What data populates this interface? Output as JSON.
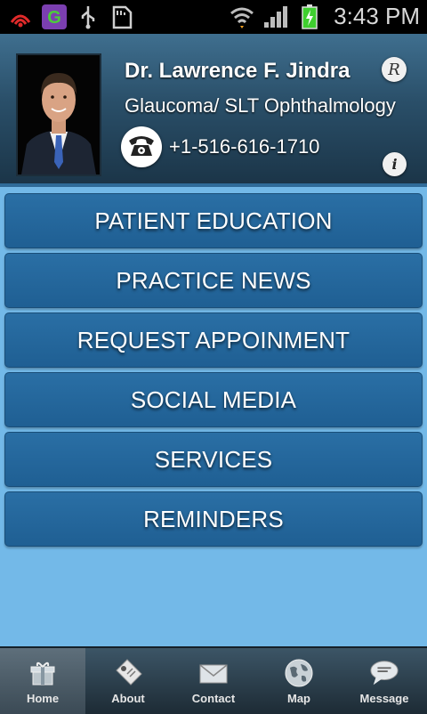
{
  "status_bar": {
    "time": "3:43 PM",
    "icons_left": [
      "signal-alert-icon",
      "app-g-icon",
      "usb-icon",
      "sd-card-icon"
    ],
    "icons_right": [
      "wifi-icon",
      "cell-signal-icon",
      "battery-charging-icon"
    ]
  },
  "header": {
    "doctor_name": "Dr. Lawrence F. Jindra",
    "specialty": "Glaucoma/ SLT Ophthalmology",
    "phone": "+1-516-616-1710",
    "r_button_label": "R",
    "info_button_label": "i"
  },
  "menu": {
    "items": [
      {
        "label": "PATIENT EDUCATION"
      },
      {
        "label": "PRACTICE NEWS"
      },
      {
        "label": "REQUEST APPOINMENT"
      },
      {
        "label": "SOCIAL MEDIA"
      },
      {
        "label": "SERVICES"
      },
      {
        "label": "REMINDERS"
      }
    ]
  },
  "bottom_nav": {
    "items": [
      {
        "label": "Home",
        "icon": "gift-icon",
        "active": true
      },
      {
        "label": "About",
        "icon": "tag-icon",
        "active": false
      },
      {
        "label": "Contact",
        "icon": "envelope-icon",
        "active": false
      },
      {
        "label": "Map",
        "icon": "globe-icon",
        "active": false
      },
      {
        "label": "Message",
        "icon": "chat-bubble-icon",
        "active": false
      }
    ]
  },
  "colors": {
    "background": "#73b9e8",
    "menu_button": "#2a6fa5",
    "header": "#2a4f69"
  }
}
